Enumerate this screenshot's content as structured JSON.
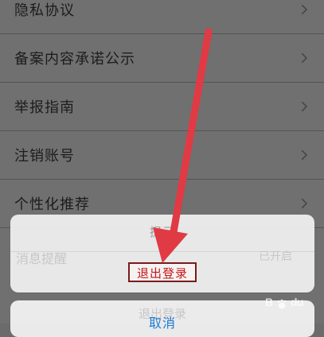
{
  "settings": {
    "items": [
      {
        "label": "隐私协议"
      },
      {
        "label": "备案内容承诺公示"
      },
      {
        "label": "举报指南"
      },
      {
        "label": "注销账号"
      },
      {
        "label": "个性化推荐"
      }
    ],
    "under_row": {
      "left_label": "消息提醒",
      "right_label": "已开启"
    }
  },
  "dialog": {
    "title": "提示",
    "confirm_label": "退出登录",
    "cancel_label": "取消",
    "under_cancel_label": "退出登录"
  },
  "colors": {
    "confirm_text": "#c41717",
    "confirm_border": "#7a1a1a",
    "cancel_text": "#1b7ad6",
    "annotation_arrow": "#e03a44"
  },
  "icons": {
    "row_chevron": "chevron-right-icon",
    "watermark_paw": "baidu-paw-icon"
  },
  "watermark": {
    "b": "B",
    "d": "d",
    "u": "u"
  }
}
